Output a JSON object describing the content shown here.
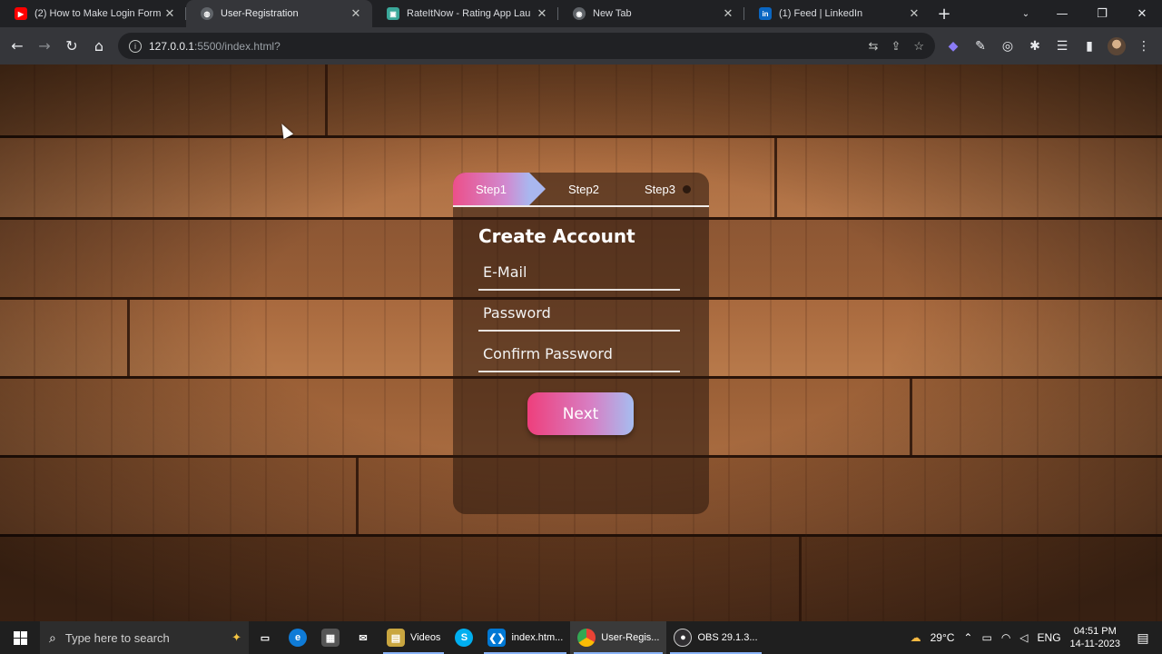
{
  "browser": {
    "tabs": [
      {
        "title": "(2) How to Make Login Form",
        "favicon": "youtube-icon",
        "color": "#ff0000",
        "glyph": "▶"
      },
      {
        "title": "User-Registration",
        "favicon": "globe-icon",
        "color": "#5f6368",
        "glyph": "◍"
      },
      {
        "title": "RateItNow - Rating App Lau",
        "favicon": "app-icon",
        "color": "#3aa89a",
        "glyph": "▣"
      },
      {
        "title": "New Tab",
        "favicon": "chrome-icon",
        "color": "#5f6368",
        "glyph": "◉"
      },
      {
        "title": "(1) Feed | LinkedIn",
        "favicon": "linkedin-icon",
        "color": "#0a66c2",
        "glyph": "in"
      }
    ],
    "active_tab": 1,
    "url_host": "127.0.0.1",
    "url_path": ":5500/index.html?"
  },
  "form": {
    "steps": [
      "Step1",
      "Step2",
      "Step3"
    ],
    "active_step": 0,
    "heading": "Create Account",
    "email_placeholder": "E-Mail",
    "password_placeholder": "Password",
    "confirm_placeholder": "Confirm Password",
    "next_label": "Next",
    "accent_start": "#ee3f7c",
    "accent_end": "#a6bdf0"
  },
  "taskbar": {
    "search_placeholder": "Type here to search",
    "apps": [
      {
        "label": "",
        "icon": "task-view-icon"
      },
      {
        "label": "",
        "icon": "edge-icon"
      },
      {
        "label": "",
        "icon": "store-icon"
      },
      {
        "label": "",
        "icon": "mail-icon"
      },
      {
        "label": "Videos",
        "icon": "video-folder-icon"
      },
      {
        "label": "",
        "icon": "skype-icon"
      },
      {
        "label": "index.htm...",
        "icon": "vscode-icon"
      },
      {
        "label": "User-Regis...",
        "icon": "chrome-icon"
      },
      {
        "label": "OBS 29.1.3...",
        "icon": "obs-icon"
      }
    ],
    "weather": "29°C",
    "language": "ENG",
    "time": "04:51 PM",
    "date": "14-11-2023"
  }
}
